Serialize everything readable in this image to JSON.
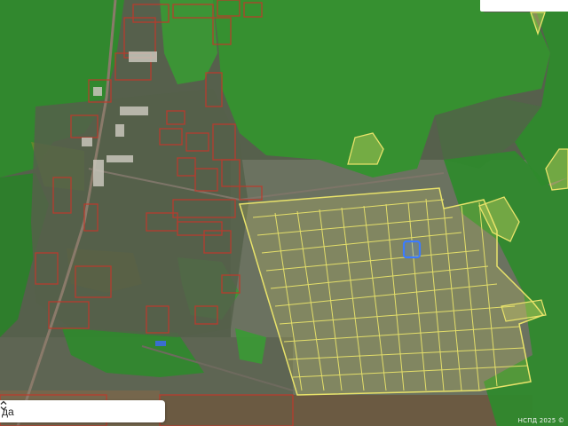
{
  "map": {
    "attribution": "НСПД 2025 ©",
    "colors": {
      "forest": "#2f8a2c",
      "forest_light": "#3fa23a",
      "settlement": "#5a6250",
      "field": "#6d7462",
      "parcel_yellow": "#e9e36a",
      "parcel_red": "#c0392b",
      "highlight_blue": "#3b7bff"
    }
  },
  "layer_select": {
    "value": "да",
    "icon": "chevron-updown-icon"
  }
}
